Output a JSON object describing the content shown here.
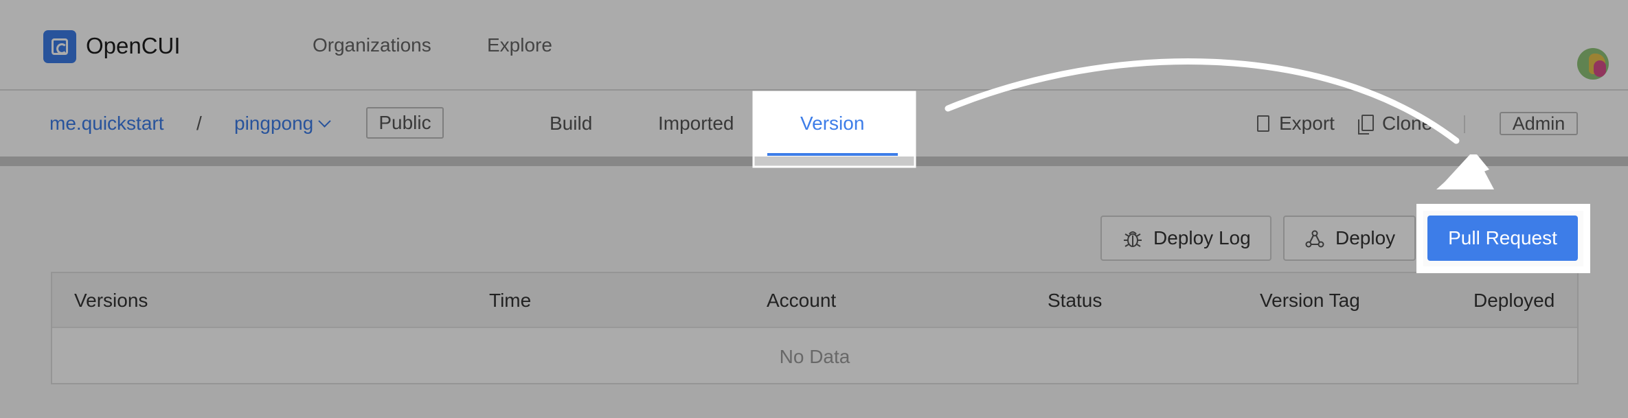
{
  "header": {
    "brand": "OpenCUI",
    "nav": [
      "Organizations",
      "Explore"
    ]
  },
  "project": {
    "org": "me.quickstart",
    "separator": "/",
    "name": "pingpong",
    "visibility": "Public",
    "tabs": [
      "Build",
      "Imported",
      "Version"
    ],
    "active_tab": "Version",
    "actions": {
      "export": "Export",
      "clone": "Clone",
      "admin": "Admin"
    }
  },
  "toolbar": {
    "deploy_log": "Deploy Log",
    "deploy": "Deploy",
    "pull_request": "Pull Request"
  },
  "table": {
    "columns": [
      "Versions",
      "Time",
      "Account",
      "Status",
      "Version Tag",
      "Deployed"
    ],
    "empty_text": "No Data"
  },
  "colors": {
    "accent": "#3d7de8",
    "overlay": "rgba(0,0,0,0.33)"
  }
}
